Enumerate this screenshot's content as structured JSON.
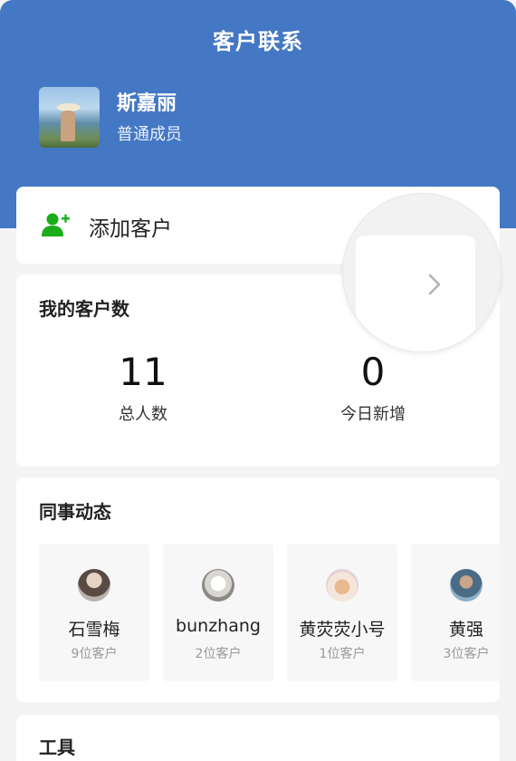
{
  "header": {
    "title": "客户联系"
  },
  "profile": {
    "name": "斯嘉丽",
    "role": "普通成员"
  },
  "add_customer": {
    "label": "添加客户"
  },
  "customer_count": {
    "title": "我的客户数",
    "total": {
      "value": "11",
      "label": "总人数"
    },
    "today": {
      "value": "0",
      "label": "今日新增"
    }
  },
  "colleagues": {
    "title": "同事动态",
    "items": [
      {
        "name": "石雪梅",
        "count": "9位客户"
      },
      {
        "name": "bunzhang",
        "count": "2位客户"
      },
      {
        "name": "黄荧荧小号",
        "count": "1位客户"
      },
      {
        "name": "黄强",
        "count": "3位客户"
      }
    ]
  },
  "tools": {
    "title": "工具"
  },
  "colors": {
    "header": "#4477c4",
    "add_icon": "#1aad19"
  },
  "icons": {
    "add_customer": "add-user-icon",
    "enter": "chevron-right-icon"
  }
}
